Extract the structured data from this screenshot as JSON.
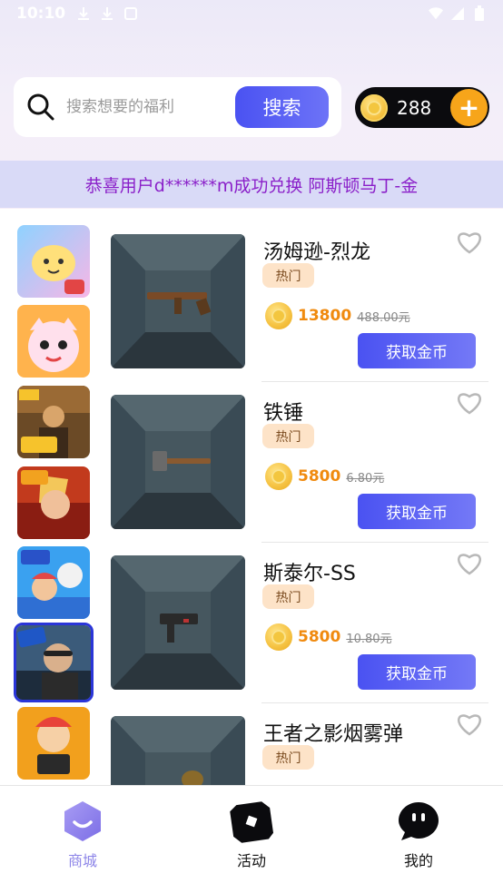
{
  "status_bar": {
    "time": "10:10"
  },
  "search": {
    "placeholder": "搜索想要的福利",
    "button_label": "搜索"
  },
  "coins": {
    "balance": "288",
    "add_label": "+"
  },
  "marquee": {
    "text": "恭喜用户d******m成功兑换 阿斯顿马丁-金"
  },
  "sidebar": {
    "selected_index": 5,
    "games": [
      "game-1",
      "game-2",
      "game-3",
      "game-4",
      "game-5",
      "game-6",
      "game-7"
    ]
  },
  "products": [
    {
      "name": "汤姆逊-烈龙",
      "badge": "热门",
      "coin_price": "13800",
      "original_price": "488.00元",
      "button_label": "获取金币"
    },
    {
      "name": "铁锤",
      "badge": "热门",
      "coin_price": "5800",
      "original_price": "6.80元",
      "button_label": "获取金币"
    },
    {
      "name": "斯泰尔-SS",
      "badge": "热门",
      "coin_price": "5800",
      "original_price": "10.80元",
      "button_label": "获取金币"
    },
    {
      "name": "王者之影烟雾弹",
      "badge": "热门",
      "coin_price": "",
      "original_price": "",
      "button_label": ""
    }
  ],
  "bottom_nav": {
    "items": [
      {
        "label": "商城",
        "icon": "smile-shop-icon",
        "active": true
      },
      {
        "label": "活动",
        "icon": "activity-icon",
        "active": false
      },
      {
        "label": "我的",
        "icon": "chat-face-icon",
        "active": false
      }
    ]
  },
  "colors": {
    "accent": "#4a52f2",
    "coin": "#f08a0e",
    "marquee_text": "#8a1fc9",
    "nav_active": "#8d85e8",
    "selected_border": "#2a35d8"
  }
}
